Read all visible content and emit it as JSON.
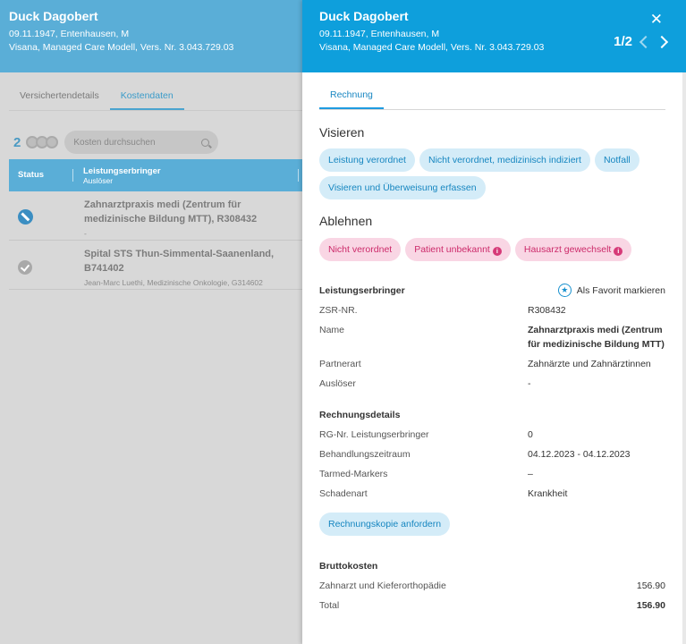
{
  "patient": {
    "name": "Duck Dagobert",
    "info": "09.11.1947, Entenhausen, M",
    "insurance": "Visana, Managed Care Modell, Vers. Nr. 3.043.729.03"
  },
  "left": {
    "tabs": [
      {
        "label": "Versichertendetails"
      },
      {
        "label": "Kostendaten"
      }
    ],
    "count": "2",
    "search_placeholder": "Kosten durchsuchen",
    "table": {
      "col_status": "Status",
      "col_provider": "Leistungserbringer",
      "col_provider_sub": "Auslöser"
    },
    "rows": [
      {
        "title": "Zahnarztpraxis medi (Zentrum für medizinische Bildung MTT), R308432",
        "meta": "-",
        "status": "blocked"
      },
      {
        "title": "Spital STS Thun-Simmental-Saanenland, B741402",
        "meta": "Jean-Marc Luethi, Medizinische Onkologie, G314602",
        "status": "done"
      }
    ]
  },
  "drawer": {
    "pager": "1/2",
    "tab": "Rechnung",
    "visieren": {
      "title": "Visieren",
      "chips": [
        "Leistung verordnet",
        "Nicht verordnet, medizinisch indiziert",
        "Notfall",
        "Visieren und Überweisung erfassen"
      ]
    },
    "ablehnen": {
      "title": "Ablehnen",
      "chips": [
        "Nicht verordnet",
        "Patient unbekannt",
        "Hausarzt gewechselt"
      ]
    },
    "provider": {
      "title": "Leistungserbringer",
      "favorite": "Als Favorit markieren",
      "zsr_label": "ZSR-NR.",
      "zsr_value": "R308432",
      "name_label": "Name",
      "name_line1": "Zahnarztpraxis medi (Zentrum",
      "name_line2": "für medizinische Bildung MTT)",
      "partner_label": "Partnerart",
      "partner_value": "Zahnärzte und Zahnärztinnen",
      "trigger_label": "Auslöser",
      "trigger_value": "-"
    },
    "invoice": {
      "title": "Rechnungsdetails",
      "rg_label": "RG-Nr. Leistungserbringer",
      "rg_value": "0",
      "period_label": "Behandlungszeitraum",
      "period_value": "04.12.2023 - 04.12.2023",
      "tarmed_label": "Tarmed-Markers",
      "tarmed_value": "–",
      "damage_label": "Schadenart",
      "damage_value": "Krankheit",
      "copy_button": "Rechnungskopie anfordern"
    },
    "gross": {
      "title": "Bruttokosten",
      "item_label": "Zahnarzt und Kieferorthopädie",
      "item_value": "156.90",
      "total_label": "Total",
      "total_value": "156.90"
    }
  },
  "colors": {
    "header_blue": "#0e9fdc",
    "chip_blue_bg": "#d4ecf8",
    "chip_pink_bg": "#f9d6e4",
    "accent_pink": "#d63a78"
  }
}
